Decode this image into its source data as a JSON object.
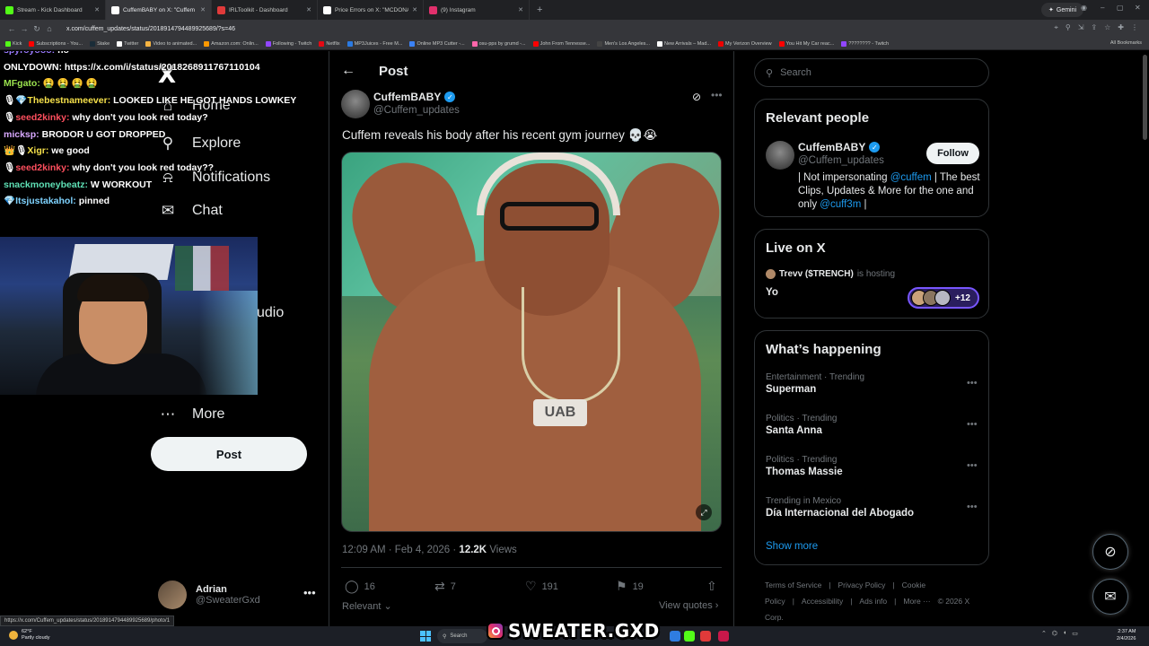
{
  "browser": {
    "tabs": [
      {
        "title": "Stream - Kick Dashboard",
        "color": "#53fc18"
      },
      {
        "title": "CuffemBABY on X: \"Cuffem reve",
        "color": "#ffffff",
        "active": true
      },
      {
        "title": "IRLToolkit - Dashboard",
        "color": "#e03a3a"
      },
      {
        "title": "Price Errors on X: \"MCDONALD",
        "color": "#ffffff"
      },
      {
        "title": "(9) Instagram",
        "color": "#e1306c"
      }
    ],
    "new_tab": "+",
    "gemini_label": "Gemini",
    "url": "x.com/cuffem_updates/status/2018914794489925689/?s=46",
    "bookmarks": [
      {
        "label": "Kick",
        "color": "#53fc18"
      },
      {
        "label": "Subscriptions - You...",
        "color": "#ff0000"
      },
      {
        "label": "Stake",
        "color": "#1a2c38"
      },
      {
        "label": "Twitter",
        "color": "#ffffff"
      },
      {
        "label": "Video to animated...",
        "color": "#f5b342"
      },
      {
        "label": "Amazon.com: Onlin...",
        "color": "#ff9900"
      },
      {
        "label": "Following - Twitch",
        "color": "#9146ff"
      },
      {
        "label": "Netflix",
        "color": "#e50914"
      },
      {
        "label": "MP3Juices - Free M...",
        "color": "#2a7ae2"
      },
      {
        "label": "Online MP3 Cutter -...",
        "color": "#3b82f6"
      },
      {
        "label": "osu-pps by grumd -...",
        "color": "#ff66aa"
      },
      {
        "label": "John From Tennesse...",
        "color": "#ff0000"
      },
      {
        "label": "Men's Los Angeles...",
        "color": "#444444"
      },
      {
        "label": "New Arrivals – Mad...",
        "color": "#ffffff"
      },
      {
        "label": "My Verizon Overview",
        "color": "#ee0000"
      },
      {
        "label": "You Hit My Car reac...",
        "color": "#ff0000"
      },
      {
        "label": "???????? - Twitch",
        "color": "#9146ff"
      }
    ],
    "all_bookmarks": "All Bookmarks",
    "status_url": "https://x.com/Cuffem_updates/status/2018914794489925689/photo/1"
  },
  "stream_overlay": {
    "chat": [
      {
        "user": "spyroyooo:",
        "msg": "no",
        "color": "#9b7bff",
        "emote": ""
      },
      {
        "user": "",
        "msg": "ONLYDOWN: https://x.com/i/status/2018268911767110104",
        "color": "#ffffff",
        "emote": ""
      },
      {
        "user": "MFgato:",
        "msg": "🤮 🤮 🤮 🤮",
        "color": "#9be34f",
        "emote": ""
      },
      {
        "user": "Thebestnameever:",
        "msg": "LOOKED LIKE HE GOT HANDS LOWKEY",
        "color": "#f5e04a",
        "emote": "🎙💎"
      },
      {
        "user": "seed2kinky:",
        "msg": "why don't you look red today?",
        "color": "#ff4f5e",
        "emote": "🎙"
      },
      {
        "user": "micksp:",
        "msg": "BRODOR U GOT DROPPED",
        "color": "#d8a8ff",
        "emote": ""
      },
      {
        "user": "Xigr:",
        "msg": "we good",
        "color": "#f5e04a",
        "emote": "👑🎙"
      },
      {
        "user": "seed2kinky:",
        "msg": "why don't you look red today??",
        "color": "#ff4f5e",
        "emote": "🎙"
      },
      {
        "user": "snackmoneybeatz:",
        "msg": "W WORKOUT",
        "color": "#5ee0b5",
        "emote": ""
      },
      {
        "user": "Itsjustakahol:",
        "msg": "pinned",
        "color": "#7fd3ff",
        "emote": "💎"
      }
    ],
    "watermark": "SWEATER.GXD"
  },
  "left_nav": {
    "logo": "X",
    "items": [
      {
        "label": "Home",
        "icon": "home-icon",
        "glyph": "⌂"
      },
      {
        "label": "Explore",
        "icon": "search-icon",
        "glyph": "⚲"
      },
      {
        "label": "Notifications",
        "icon": "bell-icon",
        "glyph": "⍾"
      },
      {
        "label": "Chat",
        "icon": "mail-icon",
        "glyph": "✉"
      }
    ],
    "partial_items": [
      "s",
      "udio"
    ],
    "more": {
      "label": "More",
      "icon": "more-circle-icon",
      "glyph": "⋯"
    },
    "post_button": "Post",
    "account": {
      "name": "Adrian",
      "handle": "@SweaterGxd",
      "more": "•••"
    }
  },
  "main": {
    "header_title": "Post",
    "back_glyph": "←",
    "tweet": {
      "author_name": "CuffemBABY",
      "author_handle": "@Cuffem_updates",
      "verified_glyph": "✓",
      "text": "Cuffem reveals his body after his recent gym journey 💀😭",
      "media_pendant_text": "UAB",
      "time": "12:09 AM · Feb 4, 2026 ·",
      "views_count": "12.2K",
      "views_label": "Views",
      "replies": "16",
      "reposts": "7",
      "likes": "191",
      "bookmarks": "19",
      "relevant_label": "Relevant",
      "view_quotes_label": "View quotes"
    }
  },
  "right": {
    "search_placeholder": "Search",
    "relevant_people": {
      "title": "Relevant people",
      "name": "CuffemBABY",
      "handle": "@Cuffem_updates",
      "follow_label": "Follow",
      "bio_1": "| Not impersonating ",
      "bio_link_1": "@cuffem",
      "bio_2": " | The best Clips, Updates & More for the one and only ",
      "bio_link_2": "@cuff3m",
      "bio_3": " |"
    },
    "live": {
      "title": "Live on X",
      "host_name": "Trevv ($TRENCH)",
      "host_suffix": "is hosting",
      "space_title": "Yo",
      "extra_count": "+12"
    },
    "happening": {
      "title": "What’s happening",
      "trends": [
        {
          "category": "Entertainment · Trending",
          "name": "Superman"
        },
        {
          "category": "Politics · Trending",
          "name": "Santa Anna"
        },
        {
          "category": "Politics · Trending",
          "name": "Thomas Massie"
        },
        {
          "category": "Trending in Mexico",
          "name": "Día Internacional del Abogado"
        }
      ],
      "show_more": "Show more"
    },
    "footer": [
      "Terms of Service",
      "|",
      "Privacy Policy",
      "|",
      "Cookie Policy",
      "|",
      "Accessibility",
      "|",
      "Ads info",
      "|",
      "More ···",
      "© 2026 X Corp."
    ]
  },
  "taskbar": {
    "weather_temp": "62°F",
    "weather_desc": "Partly cloudy",
    "search_label": "Search",
    "time": "2:37 AM",
    "date": "2/4/2026"
  }
}
